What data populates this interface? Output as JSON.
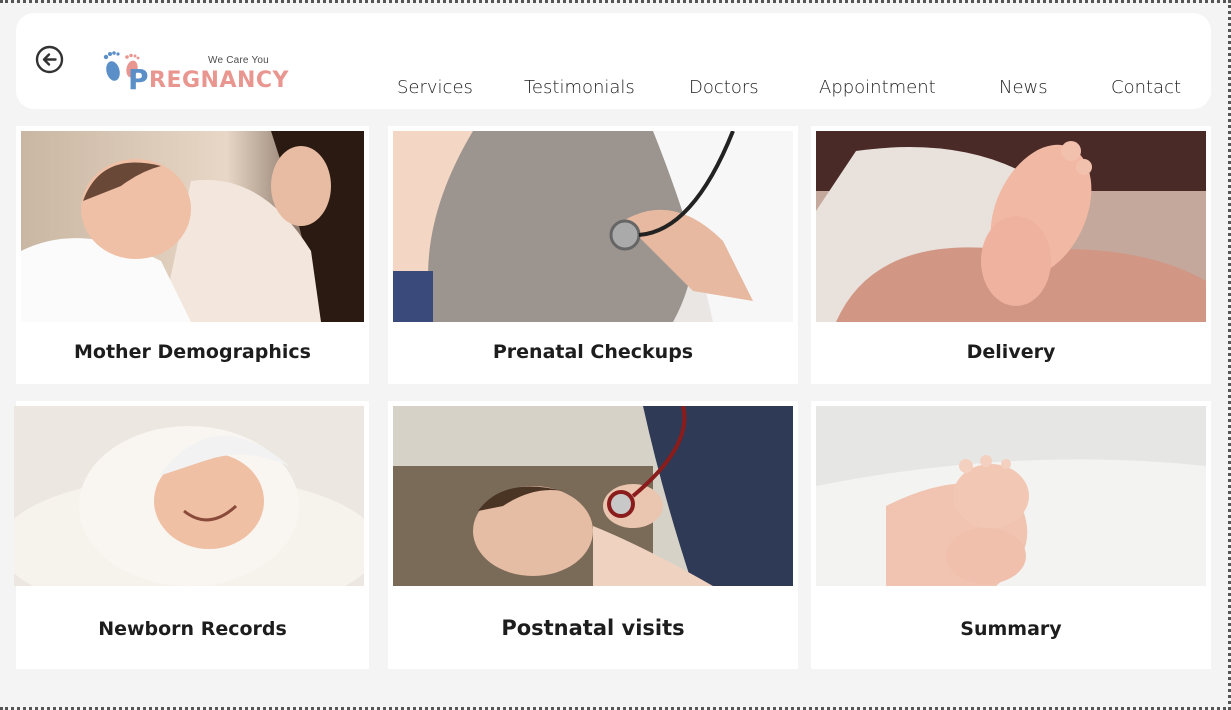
{
  "header": {
    "back_icon": "circle-arrow-left-icon",
    "logo": {
      "tagline": "We Care You",
      "brand_initial": "P",
      "brand_rest": "REGNANCY",
      "icon": "baby-feet-icon",
      "colors": {
        "brand": "#e8968f",
        "initial": "#5b8fc7"
      }
    },
    "nav": [
      "Services",
      "Testimonials",
      "Doctors",
      "Appointment",
      "News",
      "Contact"
    ]
  },
  "cards": [
    {
      "title": "Mother Demographics",
      "image": "mother-holding-newborn-photo"
    },
    {
      "title": "Prenatal Checkups",
      "image": "stethoscope-on-pregnant-belly-photo"
    },
    {
      "title": "Delivery",
      "image": "newborn-feet-in-hands-photo"
    },
    {
      "title": "Newborn Records",
      "image": "smiling-baby-in-white-hat-photo"
    },
    {
      "title": "Postnatal visits",
      "image": "doctor-examining-baby-photo"
    },
    {
      "title": "Summary",
      "image": "baby-feet-on-white-blanket-photo"
    }
  ]
}
